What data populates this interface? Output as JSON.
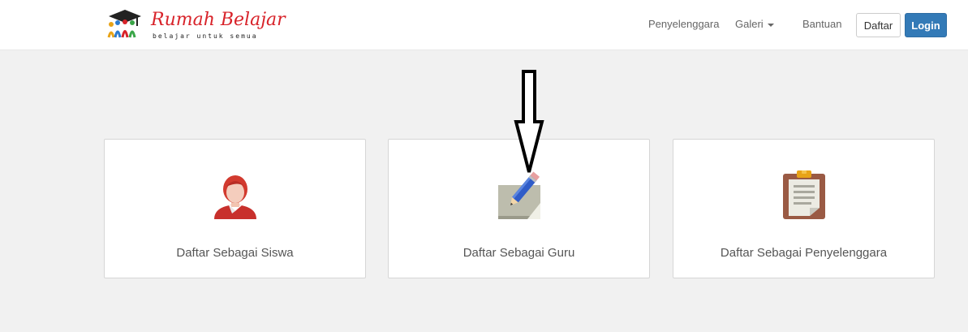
{
  "brand": {
    "title": "Rumah Belajar",
    "tagline": "belajar untuk semua",
    "logo_icon": "people-graduation-logo-icon"
  },
  "nav": {
    "links": [
      {
        "label": "Penyelenggara"
      },
      {
        "label": "Galeri",
        "icon": "caret-down-icon"
      },
      {
        "label": "Bantuan"
      }
    ],
    "daftar_label": "Daftar",
    "login_label": "Login"
  },
  "cards": [
    {
      "label": "Daftar Sebagai Siswa",
      "icon": "student-avatar-icon"
    },
    {
      "label": "Daftar Sebagai Guru",
      "icon": "pencil-paper-icon"
    },
    {
      "label": "Daftar Sebagai Penyelenggara",
      "icon": "clipboard-icon"
    }
  ],
  "annotation": {
    "icon": "down-arrow-icon"
  },
  "colors": {
    "brand_red": "#d8232a",
    "primary_blue": "#337ab7",
    "background": "#f1f1f1",
    "card_border": "#d6d6d6"
  }
}
